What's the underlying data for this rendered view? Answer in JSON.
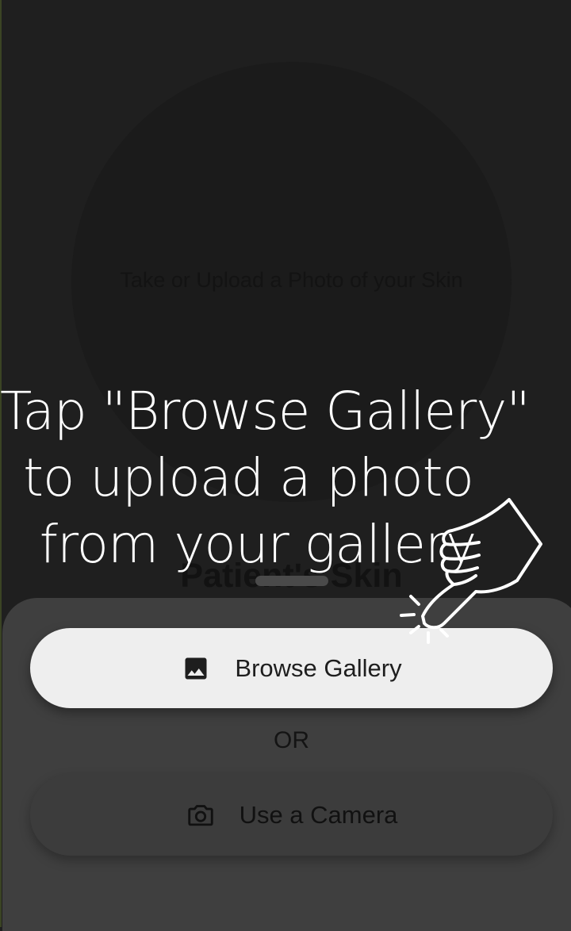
{
  "upload_area": {
    "placeholder": "Take or Upload a Photo of your Skin",
    "section_title": "Patient's Skin"
  },
  "bottom_sheet": {
    "gallery_label": "Browse Gallery",
    "gallery_icon": "image-icon",
    "separator": "OR",
    "camera_label": "Use a Camera",
    "camera_icon": "camera-icon"
  },
  "tutorial": {
    "lines": [
      "Tap \"Browse Gallery\"",
      "to upload a photo",
      "from your gallery"
    ],
    "pointer_icon": "pointing-hand-icon"
  },
  "colors": {
    "background": "#1f1f1f",
    "sheet": "#3f3f3f",
    "highlight_button": "#eeeeee",
    "overlay_text": "#ffffff"
  }
}
